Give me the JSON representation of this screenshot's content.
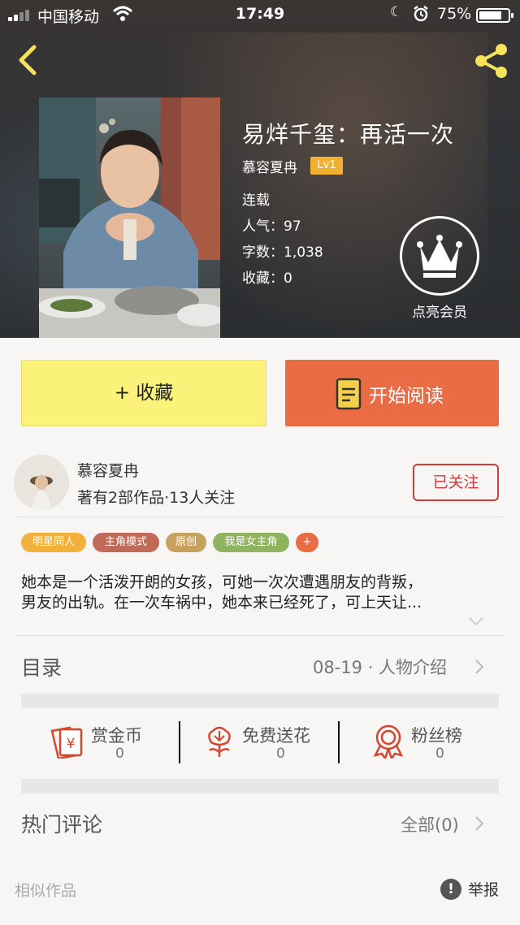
{
  "status_bar": {
    "carrier": "中国移动",
    "time": "17:49",
    "battery": "75%",
    "battery_level": 0.75
  },
  "book": {
    "title": "易烊千玺：再活一次",
    "author": "慕容夏冉",
    "level": "Lv1",
    "status": "连载",
    "popularity_label": "人气：",
    "popularity": "97",
    "words_label": "字数：",
    "words": "1,038",
    "favorites_label": "收藏：",
    "favorites": "0"
  },
  "vip": {
    "label": "点亮会员"
  },
  "actions": {
    "favorite_label": "+ 收藏",
    "read_label": "开始阅读"
  },
  "author_card": {
    "name": "慕容夏冉",
    "stats": "著有2部作品·13人关注",
    "follow_label": "已关注"
  },
  "tags": [
    {
      "label": "明星同人",
      "color": "#f2b13a"
    },
    {
      "label": "主角模式",
      "color": "#c06b5a"
    },
    {
      "label": "原创",
      "color": "#c7a15e"
    },
    {
      "label": "我是女主角",
      "color": "#8fb35e"
    },
    {
      "label": "+",
      "color": "#ea6c44"
    }
  ],
  "description": {
    "line1": "她本是一个活泼开朗的女孩，可她一次次遭遇朋友的背叛，",
    "line2": "男友的出轨。在一次车祸中，她本来已经死了，可上天让..."
  },
  "toc": {
    "label": "目录",
    "latest": "08-19 · 人物介绍"
  },
  "stats": {
    "coins": {
      "label": "赏金币",
      "value": "0",
      "icon": "red-envelope-yen-icon"
    },
    "flowers": {
      "label": "免费送花",
      "value": "0",
      "icon": "flower-icon"
    },
    "fans": {
      "label": "粉丝榜",
      "value": "0",
      "icon": "medal-icon"
    }
  },
  "comments": {
    "label": "热门评论",
    "all_label": "全部(0)"
  },
  "footer": {
    "similar": "相似作品",
    "report_icon": "!",
    "report": "举报"
  },
  "colors": {
    "accent_orange": "#ea6c44",
    "favorite_yellow": "#fbf27a",
    "follow_red": "#d43a3a",
    "level_badge": "#f3b030",
    "stat_icon_red": "#d8452e"
  }
}
